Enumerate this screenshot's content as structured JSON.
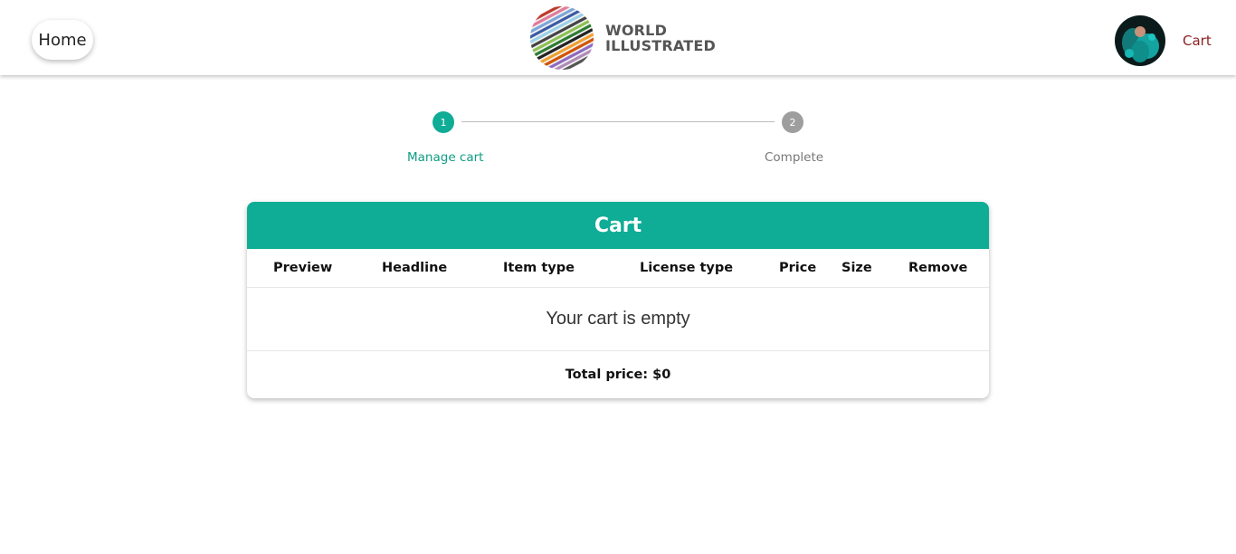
{
  "header": {
    "home_label": "Home",
    "logo_line1": "WORLD",
    "logo_line2": "ILLUSTRATED",
    "cart_link": "Cart"
  },
  "stepper": {
    "steps": [
      {
        "number": "1",
        "label": "Manage cart",
        "state": "active"
      },
      {
        "number": "2",
        "label": "Complete",
        "state": "inactive"
      }
    ]
  },
  "cart": {
    "title": "Cart",
    "columns": [
      "Preview",
      "Headline",
      "Item type",
      "License type",
      "Price",
      "Size",
      "Remove"
    ],
    "empty_message": "Your cart is empty",
    "total_label": "Total price: $0"
  },
  "colors": {
    "accent": "#0fac96",
    "cart_link": "#8b1f1f",
    "inactive_step": "#9e9e9e"
  },
  "icons": {
    "logo": "globe-stripes-logo",
    "avatar": "user-avatar"
  }
}
